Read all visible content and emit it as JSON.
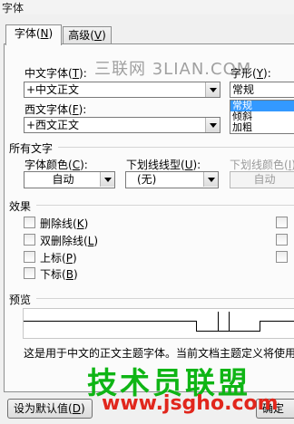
{
  "dialog": {
    "title": "字体"
  },
  "tabs": [
    {
      "label": "字体",
      "key": "N",
      "active": true
    },
    {
      "label": "高级",
      "key": "V",
      "active": false
    }
  ],
  "font": {
    "chinese_label": "中文字体",
    "chinese_key": "T",
    "chinese_value": "+中文正文",
    "western_label": "西文字体",
    "western_key": "F",
    "western_value": "+西文正文",
    "style_label": "字形",
    "style_key": "Y",
    "style_value": "常规",
    "style_options": [
      "常规",
      "倾斜",
      "加粗"
    ]
  },
  "all_text": {
    "heading": "所有文字",
    "color_label": "字体颜色",
    "color_key": "C",
    "color_value": "自动",
    "underline_label": "下划线线型",
    "underline_key": "U",
    "underline_value": "(无)",
    "underline_color_label": "下划线颜色",
    "underline_color_key": "I",
    "underline_color_value": "自动"
  },
  "effects": {
    "heading": "效果",
    "left_items": [
      {
        "label": "删除线",
        "key": "K"
      },
      {
        "label": "双删除线",
        "key": "L"
      },
      {
        "label": "上标",
        "key": "P"
      },
      {
        "label": "下标",
        "key": "B"
      }
    ]
  },
  "preview": {
    "heading": "预览",
    "description": "这是用于中文的正文主题字体。当前文档主题定义将使用"
  },
  "buttons": {
    "default_label": "设为默认值",
    "default_key": "D",
    "ok_label": "确定"
  },
  "watermark": {
    "site_text": "三联网 3LIAN.COM",
    "brand_text": "技术员联盟",
    "url_text": "www.jsgho.com"
  }
}
